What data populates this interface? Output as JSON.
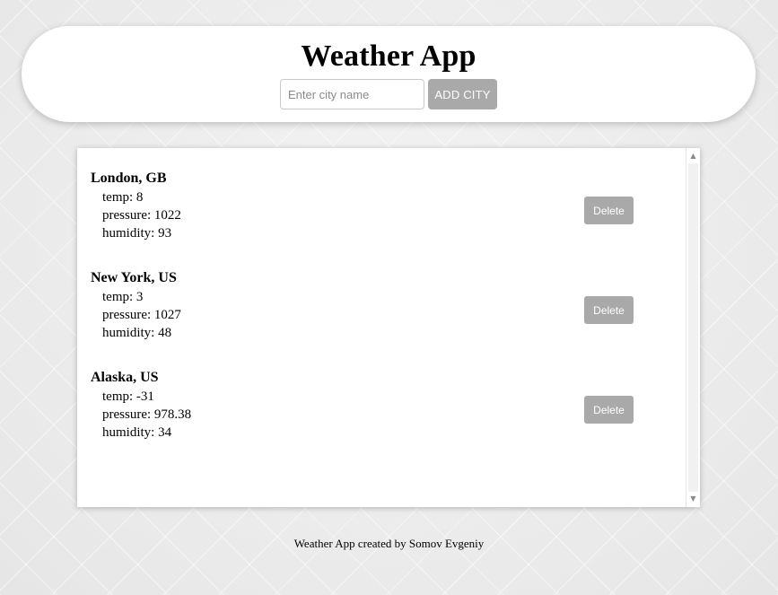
{
  "header": {
    "title": "Weather App",
    "search_placeholder": "Enter city name",
    "search_value": "",
    "add_button_label": "ADD CITY"
  },
  "cities": [
    {
      "name": "London, GB",
      "temp": "temp: 8",
      "pressure": "pressure: 1022",
      "humidity": "humidity: 93",
      "delete_label": "Delete"
    },
    {
      "name": "New York, US",
      "temp": "temp: 3",
      "pressure": "pressure: 1027",
      "humidity": "humidity: 48",
      "delete_label": "Delete"
    },
    {
      "name": "Alaska, US",
      "temp": "temp: -31",
      "pressure": "pressure: 978.38",
      "humidity": "humidity: 34",
      "delete_label": "Delete"
    }
  ],
  "scrollbar": {
    "up_icon": "scroll-up-arrow-icon",
    "down_icon": "scroll-down-arrow-icon"
  },
  "footer": {
    "text": "Weather App created by Somov Evgeniy"
  },
  "colors": {
    "button_bg": "#a9a9a9",
    "button_text": "#ffffff",
    "panel_bg": "#ffffff",
    "page_bg": "#ececec"
  }
}
